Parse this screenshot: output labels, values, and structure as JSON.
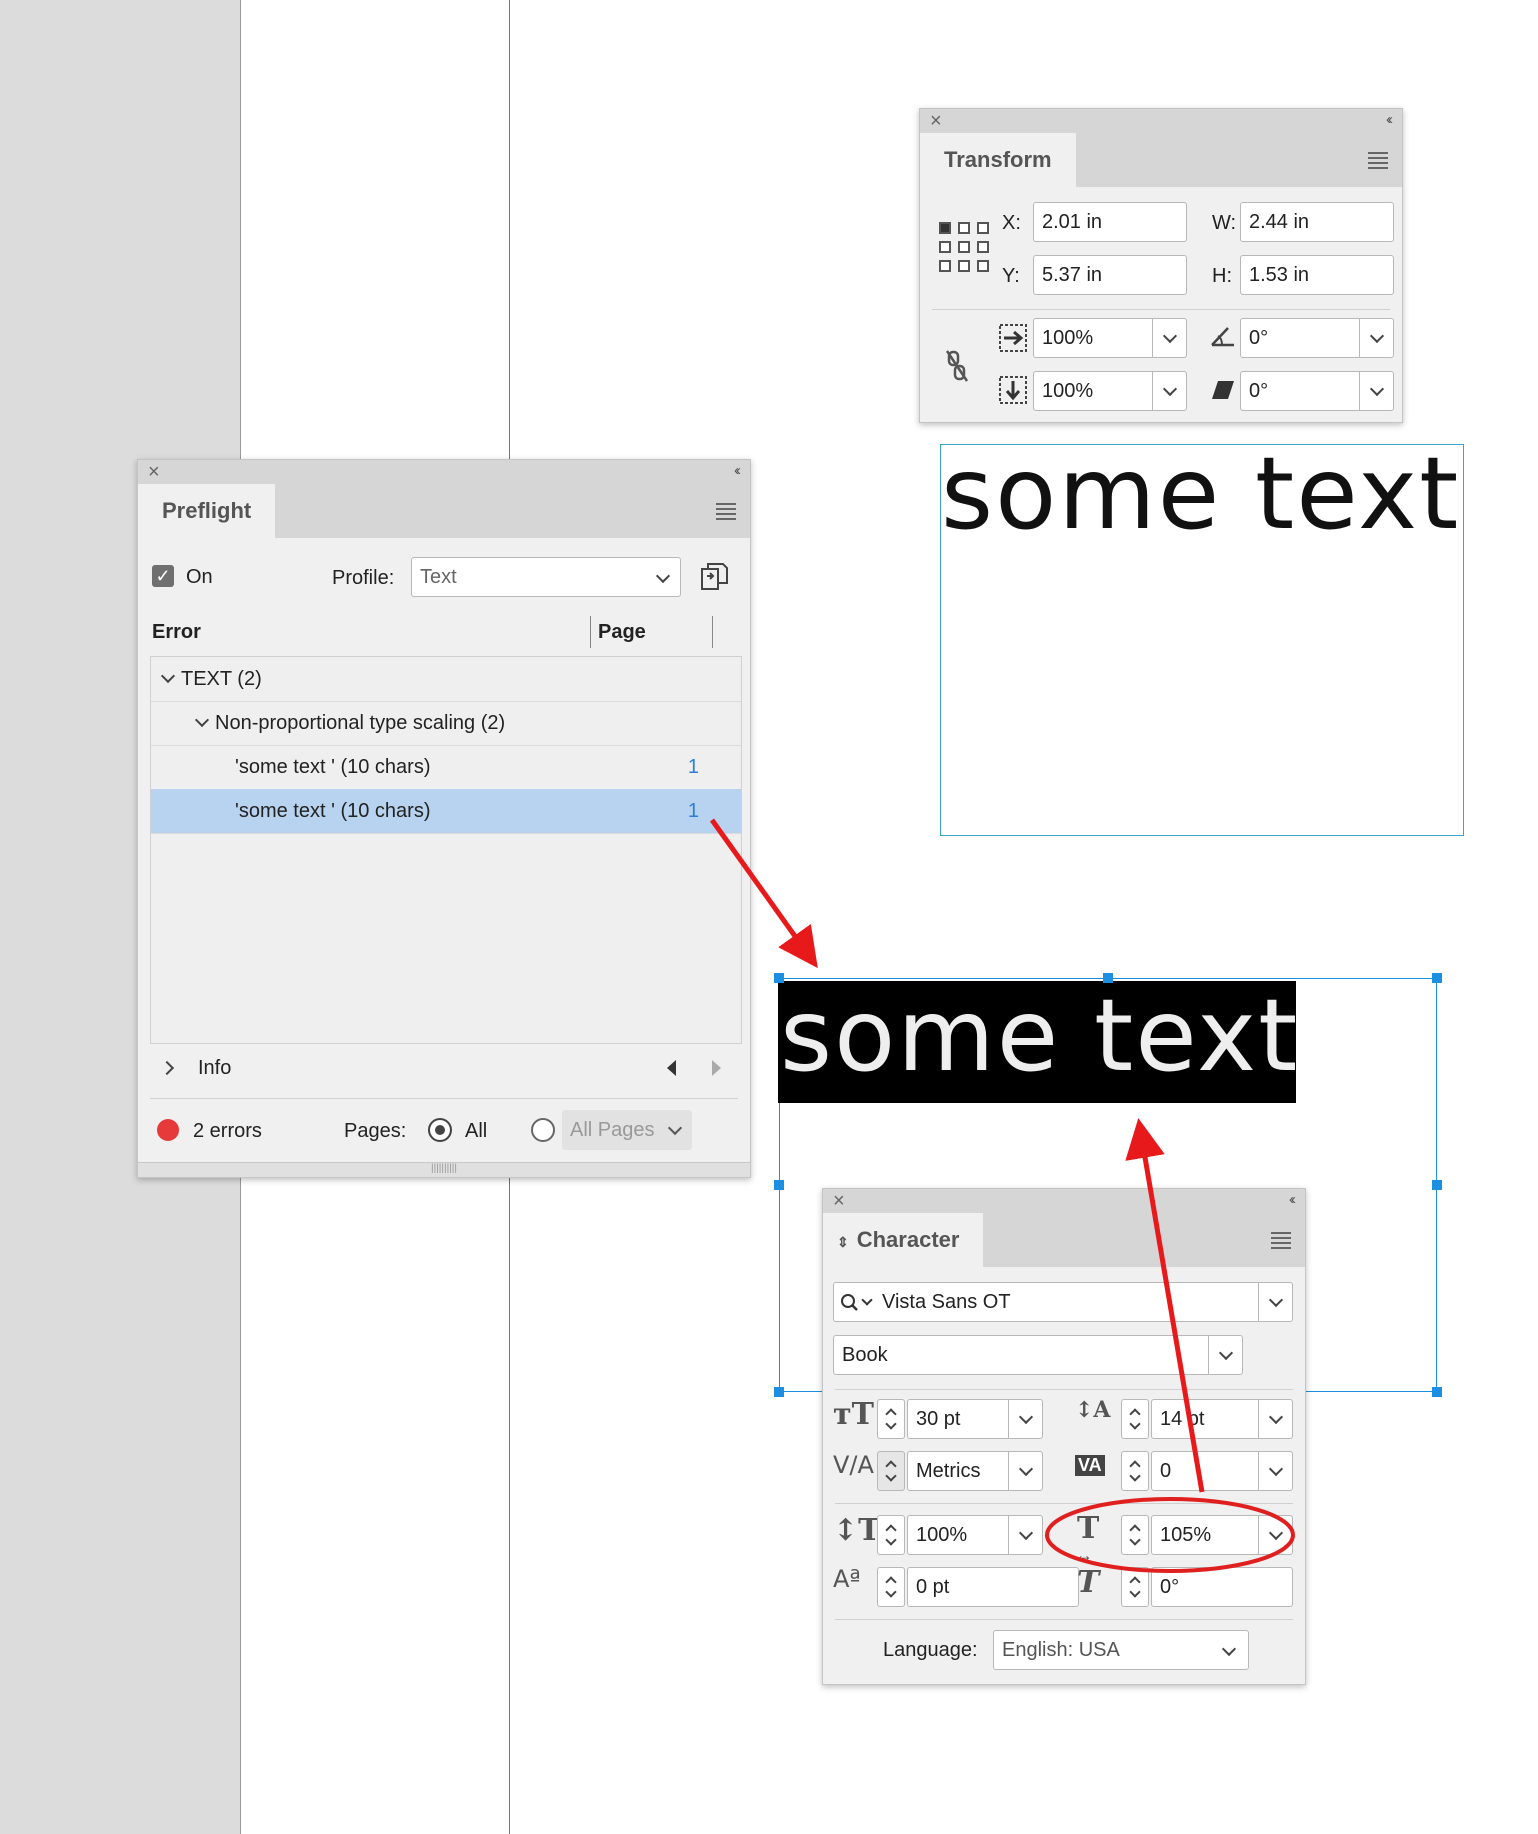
{
  "transform": {
    "title": "Transform",
    "x_label": "X:",
    "x_value": "2.01 in",
    "y_label": "Y:",
    "y_value": "5.37 in",
    "w_label": "W:",
    "w_value": "2.44 in",
    "h_label": "H:",
    "h_value": "1.53 in",
    "scale_x": "100%",
    "scale_y": "100%",
    "rotation": "0°",
    "shear": "0°"
  },
  "preflight": {
    "title": "Preflight",
    "on_label": "On",
    "profile_label": "Profile:",
    "profile_value": "Text",
    "col_error": "Error",
    "col_page": "Page",
    "group": "TEXT (2)",
    "subgroup": "Non-proportional type scaling (2)",
    "items": [
      {
        "label": "'some text ' (10 chars)",
        "page": "1"
      },
      {
        "label": "'some text ' (10 chars)",
        "page": "1"
      }
    ],
    "info_label": "Info",
    "errors_label": "2 errors",
    "pages_label": "Pages:",
    "all_label": "All",
    "all_pages_placeholder": "All Pages"
  },
  "canvas": {
    "text_top": "some text",
    "text_selected": "some text"
  },
  "character": {
    "title": "Character",
    "font_family": "Vista Sans OT",
    "font_style": "Book",
    "font_size": "30 pt",
    "leading": "14 pt",
    "kerning": "Metrics",
    "tracking": "0",
    "vertical_scale": "100%",
    "horizontal_scale": "105%",
    "baseline_shift": "0 pt",
    "skew": "0°",
    "language_label": "Language:",
    "language_value": "English: USA"
  },
  "colors": {
    "highlight_ring": "#e0201f",
    "arrow": "#e8191b",
    "selection": "#1d8fe0"
  }
}
